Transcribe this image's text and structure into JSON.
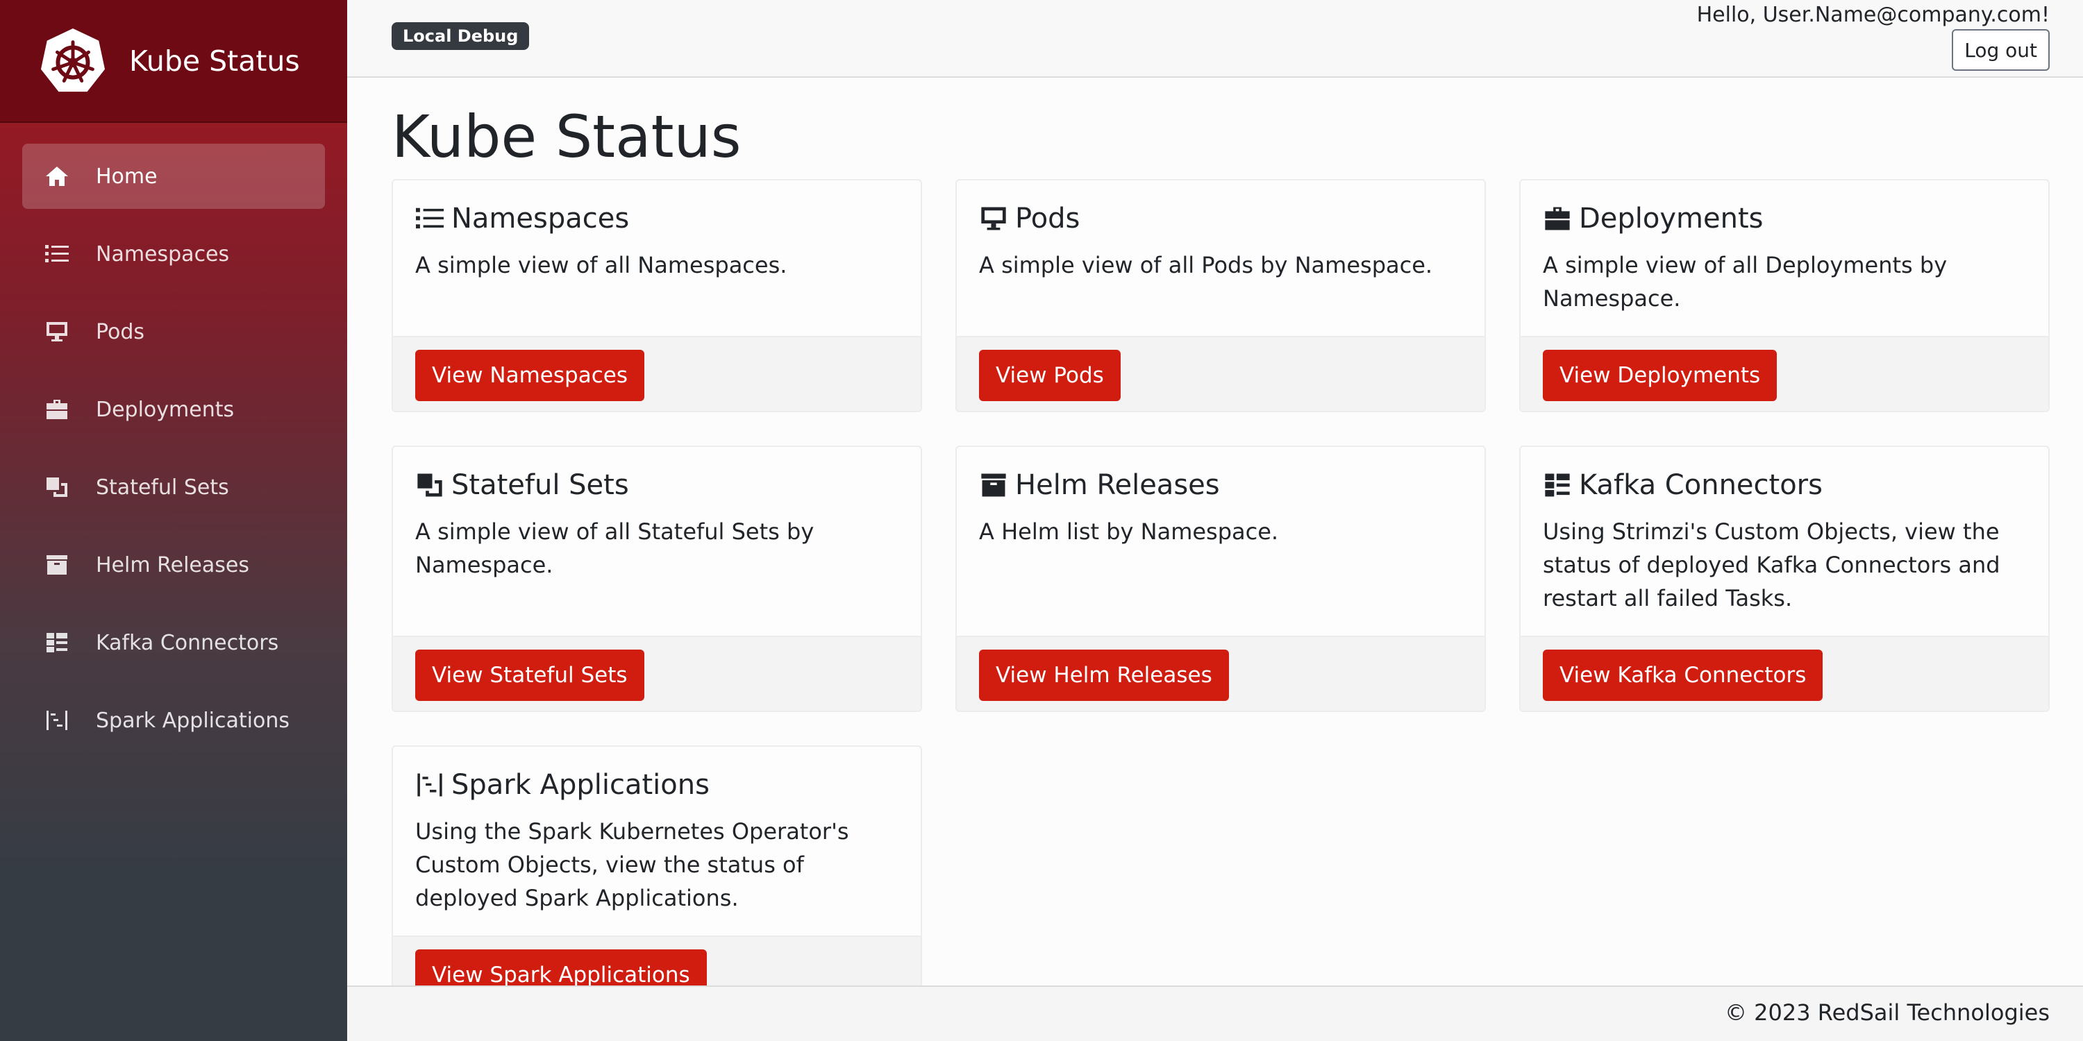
{
  "app": {
    "brand_title": "Kube Status",
    "debug_badge": "Local Debug",
    "greeting": "Hello, User.Name@company.com!",
    "logout_label": "Log out"
  },
  "sidebar": {
    "items": [
      {
        "label": "Home",
        "icon": "home-icon",
        "active": true
      },
      {
        "label": "Namespaces",
        "icon": "list-icon"
      },
      {
        "label": "Pods",
        "icon": "desktop-icon"
      },
      {
        "label": "Deployments",
        "icon": "briefcase-icon"
      },
      {
        "label": "Stateful Sets",
        "icon": "clone-icon"
      },
      {
        "label": "Helm Releases",
        "icon": "archive-icon"
      },
      {
        "label": "Kafka Connectors",
        "icon": "grid-list-icon"
      },
      {
        "label": "Spark Applications",
        "icon": "bars-staggered-icon"
      }
    ]
  },
  "main": {
    "title": "Kube Status",
    "cards": [
      {
        "title": "Namespaces",
        "text": "A simple view of all Namespaces.",
        "button": "View Namespaces"
      },
      {
        "title": "Pods",
        "text": "A simple view of all Pods by Namespace.",
        "button": "View Pods"
      },
      {
        "title": "Deployments",
        "text": "A simple view of all Deployments by Namespace.",
        "button": "View Deployments"
      },
      {
        "title": "Stateful Sets",
        "text": "A simple view of all Stateful Sets by Namespace.",
        "button": "View Stateful Sets"
      },
      {
        "title": "Helm Releases",
        "text": "A Helm list by Namespace.",
        "button": "View Helm Releases"
      },
      {
        "title": "Kafka Connectors",
        "text": "Using Strimzi's Custom Objects, view the status of deployed Kafka Connectors and restart all failed Tasks.",
        "button": "View Kafka Connectors"
      },
      {
        "title": "Spark Applications",
        "text": "Using the Spark Kubernetes Operator's Custom Objects, view the status of deployed Spark Applications.",
        "button": "View Spark Applications"
      }
    ]
  },
  "footer": {
    "copyright": "© 2023 RedSail Technologies"
  },
  "colors": {
    "accent": "#d11d10",
    "brand_dark": "#6e0a14",
    "sidebar_bottom": "#353c44"
  }
}
